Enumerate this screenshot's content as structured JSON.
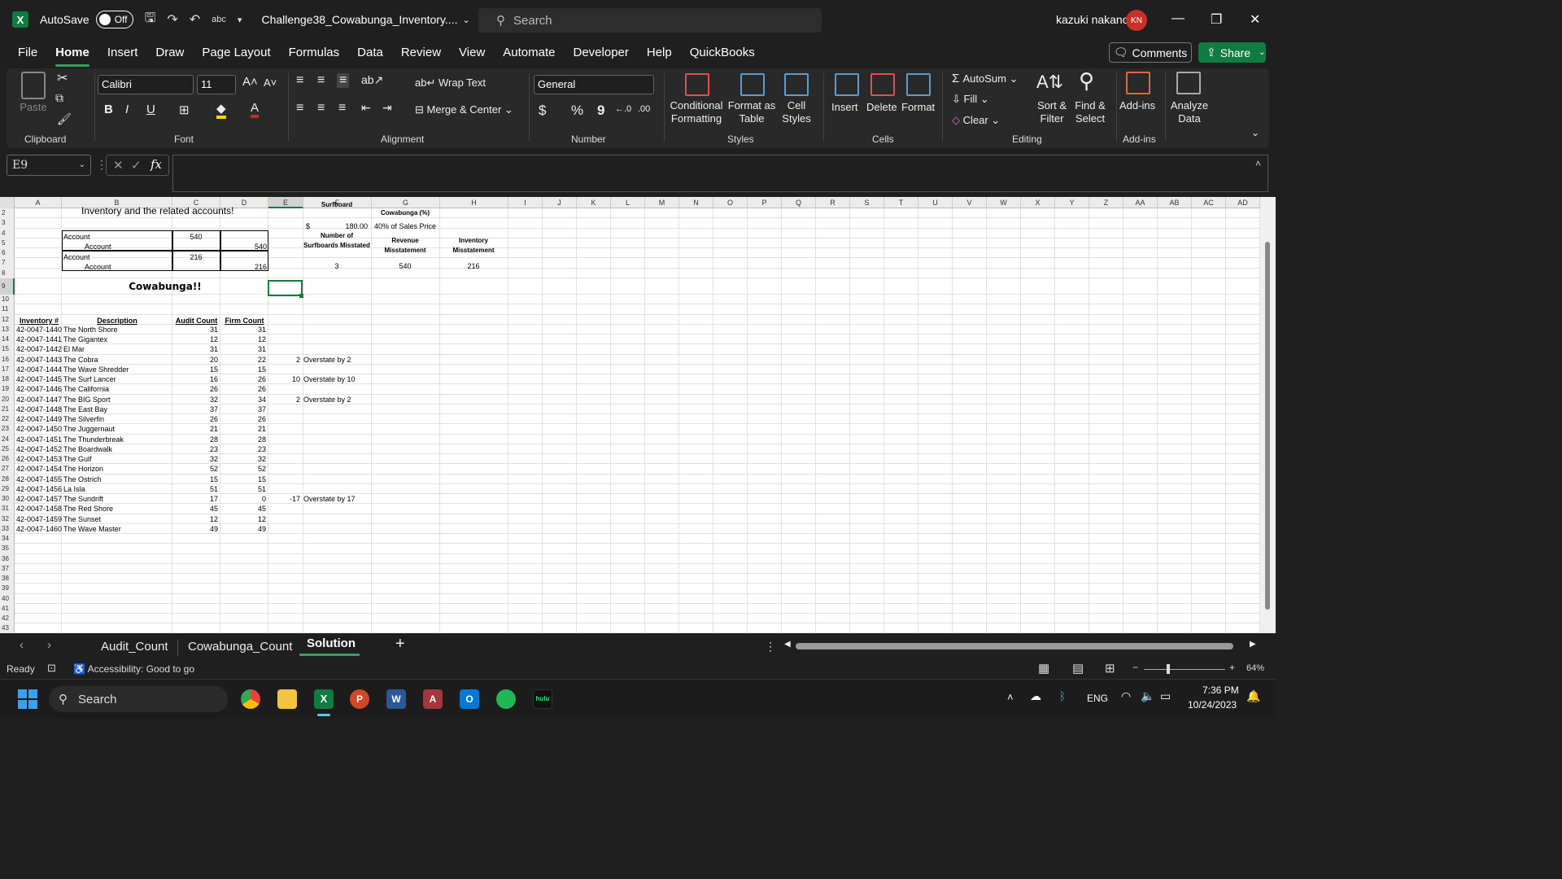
{
  "titlebar": {
    "autosave_label": "AutoSave",
    "autosave_state": "Off",
    "filename": "Challenge38_Cowabunga_Inventory....",
    "search_placeholder": "Search",
    "user_name": "kazuki nakano",
    "user_initials": "KN"
  },
  "menu": {
    "items": [
      "File",
      "Home",
      "Insert",
      "Draw",
      "Page Layout",
      "Formulas",
      "Data",
      "Review",
      "View",
      "Automate",
      "Developer",
      "Help",
      "QuickBooks"
    ],
    "active": "Home",
    "comments_label": "Comments",
    "share_label": "Share"
  },
  "ribbon": {
    "clipboard": {
      "paste": "Paste",
      "label": "Clipboard"
    },
    "font": {
      "name": "Calibri",
      "size": "11",
      "label": "Font"
    },
    "alignment": {
      "wrap": "Wrap Text",
      "merge": "Merge & Center",
      "label": "Alignment"
    },
    "number": {
      "format": "General",
      "label": "Number"
    },
    "styles": {
      "cond1": "Conditional",
      "cond2": "Formatting",
      "fmt1": "Format as",
      "fmt2": "Table",
      "cell1": "Cell",
      "cell2": "Styles",
      "label": "Styles"
    },
    "cells": {
      "insert": "Insert",
      "delete": "Delete",
      "format": "Format",
      "label": "Cells"
    },
    "editing": {
      "autosum": "AutoSum",
      "fill": "Fill",
      "clear": "Clear",
      "sort1": "Sort &",
      "sort2": "Filter",
      "find1": "Find &",
      "find2": "Select",
      "label": "Editing"
    },
    "addins": {
      "addins": "Add-ins",
      "label": "Add-ins",
      "analyze1": "Analyze",
      "analyze2": "Data"
    }
  },
  "formula_bar": {
    "name_box": "E9",
    "formula": ""
  },
  "sheet": {
    "columns": [
      "A",
      "B",
      "C",
      "D",
      "E",
      "F",
      "G",
      "H",
      "I",
      "J",
      "K",
      "L",
      "M",
      "N",
      "O",
      "P",
      "Q",
      "R",
      "S",
      "T",
      "U",
      "V",
      "W",
      "X",
      "Y",
      "Z",
      "AA",
      "AB",
      "AC",
      "AD"
    ],
    "rows_visible": [
      "2",
      "3",
      "4",
      "5",
      "6",
      "7",
      "8",
      "9",
      "10",
      "11",
      "12",
      "13",
      "14",
      "15",
      "16",
      "17",
      "18",
      "19",
      "20",
      "21",
      "22",
      "23",
      "24",
      "25",
      "26",
      "27",
      "28",
      "29",
      "30",
      "31",
      "32",
      "33",
      "34",
      "35",
      "36",
      "37",
      "38",
      "39",
      "40",
      "41",
      "42",
      "43"
    ],
    "top_text": "Inventory and the related accounts!",
    "f_header_partial": "Surfboard",
    "g_header": "Cowabunga (%)",
    "price_symbol": "$",
    "price": "180.00",
    "pct_text": "40% of Sales Price",
    "journal": [
      {
        "label": "Account",
        "debit": "540",
        "credit": ""
      },
      {
        "label": "Account",
        "debit": "",
        "credit": "540"
      },
      {
        "label": "Account",
        "debit": "216",
        "credit": ""
      },
      {
        "label": "Account",
        "debit": "",
        "credit": "216"
      }
    ],
    "summary_headers": [
      "Number of Surfboards Misstated",
      "Revenue Misstatement",
      "Inventory Misstatement"
    ],
    "summary_values": [
      "3",
      "540",
      "216"
    ],
    "cowabunga_title": "Cowabunga!!",
    "table_headers": [
      "Inventory #",
      "Description",
      "Audit Count",
      "Firm Count"
    ],
    "inventory": [
      {
        "id": "42-0047-1440",
        "desc": "The North Shore",
        "audit": "31",
        "firm": "31",
        "diff": "",
        "note": ""
      },
      {
        "id": "42-0047-1441",
        "desc": "The Gigantex",
        "audit": "12",
        "firm": "12",
        "diff": "",
        "note": ""
      },
      {
        "id": "42-0047-1442",
        "desc": "El Mar",
        "audit": "31",
        "firm": "31",
        "diff": "",
        "note": ""
      },
      {
        "id": "42-0047-1443",
        "desc": "The Cobra",
        "audit": "20",
        "firm": "22",
        "diff": "2",
        "note": "Overstate by 2"
      },
      {
        "id": "42-0047-1444",
        "desc": "The Wave Shredder",
        "audit": "15",
        "firm": "15",
        "diff": "",
        "note": ""
      },
      {
        "id": "42-0047-1445",
        "desc": "The Surf Lancer",
        "audit": "16",
        "firm": "26",
        "diff": "10",
        "note": "Overstate by 10"
      },
      {
        "id": "42-0047-1446",
        "desc": "The California",
        "audit": "26",
        "firm": "26",
        "diff": "",
        "note": ""
      },
      {
        "id": "42-0047-1447",
        "desc": "The BIG Sport",
        "audit": "32",
        "firm": "34",
        "diff": "2",
        "note": "Overstate by 2"
      },
      {
        "id": "42-0047-1448",
        "desc": "The East Bay",
        "audit": "37",
        "firm": "37",
        "diff": "",
        "note": ""
      },
      {
        "id": "42-0047-1449",
        "desc": "The Silverfin",
        "audit": "26",
        "firm": "26",
        "diff": "",
        "note": ""
      },
      {
        "id": "42-0047-1450",
        "desc": "The Juggernaut",
        "audit": "21",
        "firm": "21",
        "diff": "",
        "note": ""
      },
      {
        "id": "42-0047-1451",
        "desc": "The Thunderbreak",
        "audit": "28",
        "firm": "28",
        "diff": "",
        "note": ""
      },
      {
        "id": "42-0047-1452",
        "desc": "The Boardwalk",
        "audit": "23",
        "firm": "23",
        "diff": "",
        "note": ""
      },
      {
        "id": "42-0047-1453",
        "desc": "The Gulf",
        "audit": "32",
        "firm": "32",
        "diff": "",
        "note": ""
      },
      {
        "id": "42-0047-1454",
        "desc": "The Horizon",
        "audit": "52",
        "firm": "52",
        "diff": "",
        "note": ""
      },
      {
        "id": "42-0047-1455",
        "desc": "The Ostrich",
        "audit": "15",
        "firm": "15",
        "diff": "",
        "note": ""
      },
      {
        "id": "42-0047-1456",
        "desc": "La Isla",
        "audit": "51",
        "firm": "51",
        "diff": "",
        "note": ""
      },
      {
        "id": "42-0047-1457",
        "desc": "The Sundrift",
        "audit": "17",
        "firm": "0",
        "diff": "-17",
        "note": "Overstate by 17"
      },
      {
        "id": "42-0047-1458",
        "desc": "The Red Shore",
        "audit": "45",
        "firm": "45",
        "diff": "",
        "note": ""
      },
      {
        "id": "42-0047-1459",
        "desc": "The Sunset",
        "audit": "12",
        "firm": "12",
        "diff": "",
        "note": ""
      },
      {
        "id": "42-0047-1460",
        "desc": "The Wave Master",
        "audit": "49",
        "firm": "49",
        "diff": "",
        "note": ""
      }
    ]
  },
  "tabs": {
    "items": [
      "Audit_Count",
      "Cowabunga_Count",
      "Solution"
    ],
    "active": "Solution"
  },
  "status": {
    "ready": "Ready",
    "accessibility": "Accessibility: Good to go",
    "zoom": "64%"
  },
  "taskbar": {
    "search": "Search",
    "lang": "ENG",
    "time": "7:36 PM",
    "date": "10/24/2023",
    "hulu": "hulu"
  },
  "colors": {
    "excel_green": "#107c41",
    "accent": "#3a9e5f",
    "avatar": "#c9302c"
  }
}
